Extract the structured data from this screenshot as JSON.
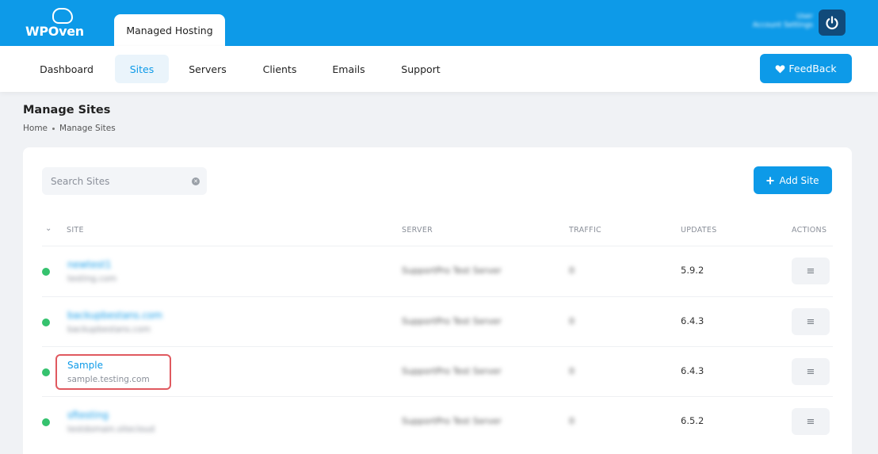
{
  "brand": {
    "name": "WPOven"
  },
  "top_tab": {
    "label": "Managed Hosting"
  },
  "account": {
    "line1": "User",
    "line2": "Account Settings"
  },
  "nav": {
    "items": [
      {
        "label": "Dashboard",
        "active": false
      },
      {
        "label": "Sites",
        "active": true
      },
      {
        "label": "Servers",
        "active": false
      },
      {
        "label": "Clients",
        "active": false
      },
      {
        "label": "Emails",
        "active": false
      },
      {
        "label": "Support",
        "active": false
      }
    ],
    "feedback_label": "FeedBack"
  },
  "page": {
    "title": "Manage Sites",
    "breadcrumb": [
      "Home",
      "Manage Sites"
    ]
  },
  "toolbar": {
    "search_placeholder": "Search Sites",
    "add_site_label": "Add Site"
  },
  "table": {
    "headers": {
      "site": "SITE",
      "server": "SERVER",
      "traffic": "TRAFFIC",
      "updates": "UPDATES",
      "actions": "ACTIONS"
    },
    "rows": [
      {
        "name": "newtest1",
        "domain": "testing.com",
        "server": "SupportPro Test Server",
        "traffic": "0",
        "version": "5.9.2",
        "status": "active",
        "blurred": true
      },
      {
        "name": "backupbestans.com",
        "domain": "backupbestans.com",
        "server": "SupportPro Test Server",
        "traffic": "0",
        "version": "6.4.3",
        "status": "active",
        "blurred": true
      },
      {
        "name": "Sample",
        "domain": "sample.testing.com",
        "server": "SupportPro Test Server",
        "traffic": "0",
        "version": "6.4.3",
        "status": "active",
        "blurred": false,
        "highlighted": true
      },
      {
        "name": "sftesting",
        "domain": "testdomain.sitecloud",
        "server": "SupportPro Test Server",
        "traffic": "0",
        "version": "6.5.2",
        "status": "active",
        "blurred": true
      }
    ]
  },
  "colors": {
    "primary": "#0d9ae8",
    "status_active": "#35c26e",
    "highlight_border": "#e0595f",
    "power_button": "#114a7a"
  },
  "icons": {
    "feedback": "heart-icon",
    "add": "plus-icon",
    "search_clear": "clear-icon",
    "power": "power-icon",
    "row_action": "menu-icon",
    "sort": "chevron-down-icon"
  }
}
